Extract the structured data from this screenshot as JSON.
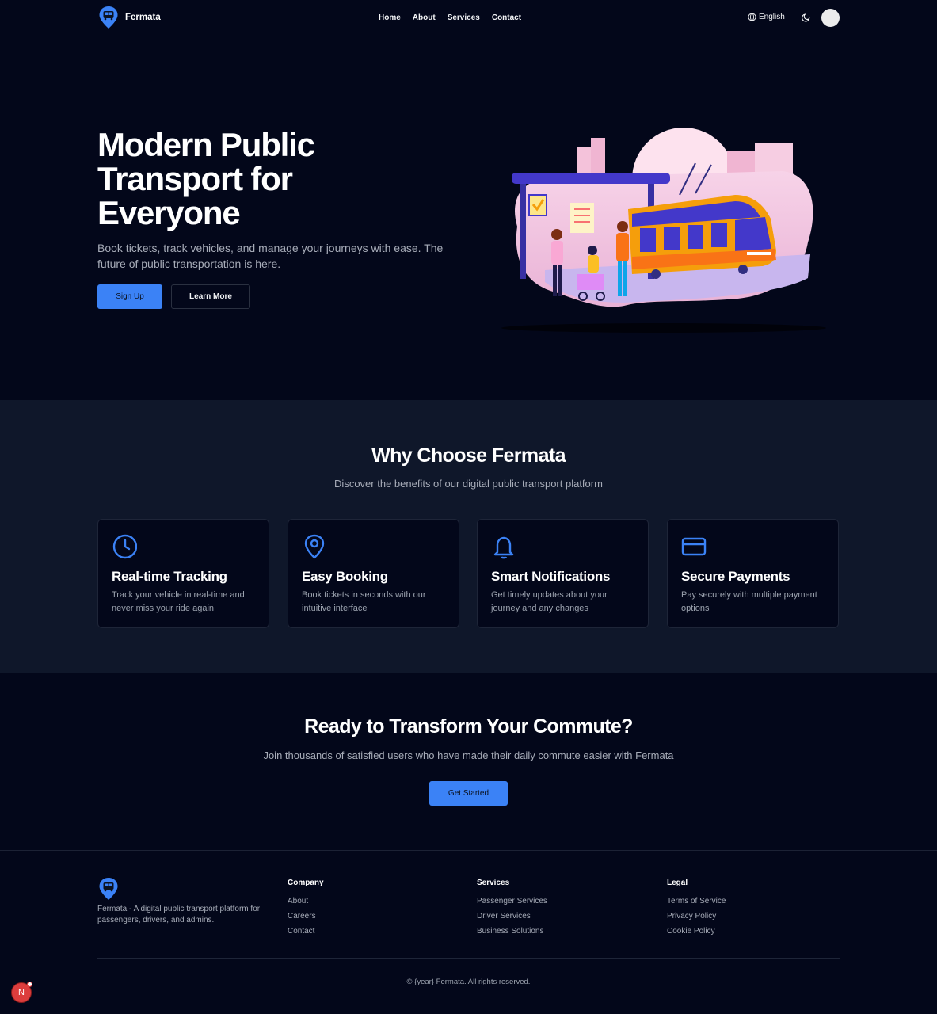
{
  "header": {
    "brand": "Fermata",
    "nav": [
      "Home",
      "About",
      "Services",
      "Contact"
    ],
    "language": "English"
  },
  "hero": {
    "title": "Modern Public Transport for Everyone",
    "subtitle": "Book tickets, track vehicles, and manage your journeys with ease. The future of public transportation is here.",
    "primary_button": "Sign Up",
    "secondary_button": "Learn More"
  },
  "features": {
    "title": "Why Choose Fermata",
    "subtitle": "Discover the benefits of our digital public transport platform",
    "cards": [
      {
        "icon": "clock-icon",
        "title": "Real-time Tracking",
        "description": "Track your vehicle in real-time and never miss your ride again"
      },
      {
        "icon": "map-pin-icon",
        "title": "Easy Booking",
        "description": "Book tickets in seconds with our intuitive interface"
      },
      {
        "icon": "bell-icon",
        "title": "Smart Notifications",
        "description": "Get timely updates about your journey and any changes"
      },
      {
        "icon": "credit-card-icon",
        "title": "Secure Payments",
        "description": "Pay securely with multiple payment options"
      }
    ]
  },
  "cta": {
    "title": "Ready to Transform Your Commute?",
    "subtitle": "Join thousands of satisfied users who have made their daily commute easier with Fermata",
    "button": "Get Started"
  },
  "footer": {
    "description": "Fermata - A digital public transport platform for passengers, drivers, and admins.",
    "columns": [
      {
        "heading": "Company",
        "links": [
          "About",
          "Careers",
          "Contact"
        ]
      },
      {
        "heading": "Services",
        "links": [
          "Passenger Services",
          "Driver Services",
          "Business Solutions"
        ]
      },
      {
        "heading": "Legal",
        "links": [
          "Terms of Service",
          "Privacy Policy",
          "Cookie Policy"
        ]
      }
    ],
    "copyright": "© {year} Fermata. All rights reserved."
  },
  "dev_badge": "N",
  "colors": {
    "accent": "#3b82f6",
    "background": "#03071a",
    "section_bg": "#0f172a",
    "badge": "#dc3d3d"
  }
}
